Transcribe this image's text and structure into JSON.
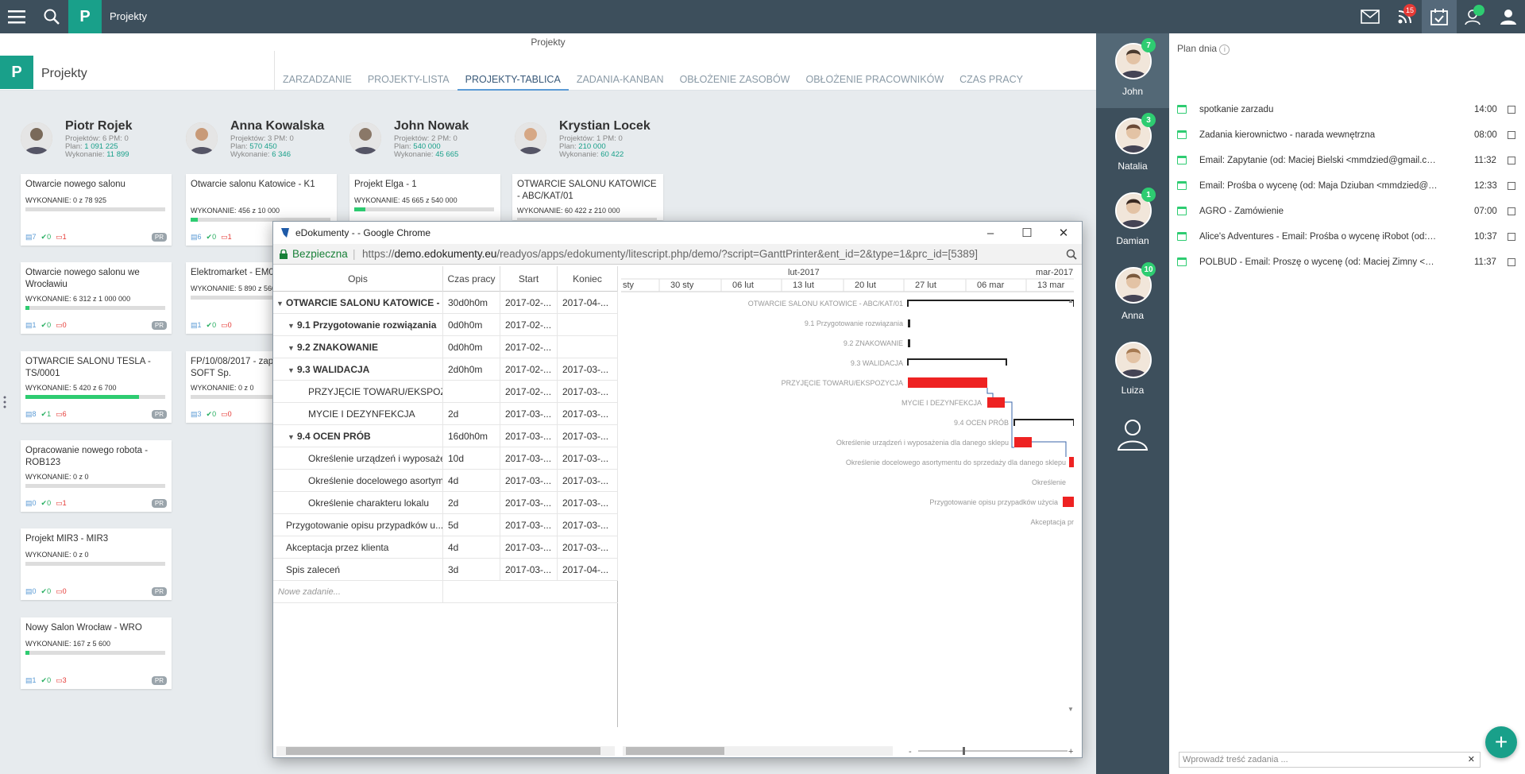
{
  "topbar": {
    "title": "Projekty",
    "notif_badge": "15",
    "logo": "P"
  },
  "breadcrumb": "Projekty",
  "header": {
    "title": "Projekty",
    "tabs": [
      "ZARZADZANIE",
      "PROJEKTY-LISTA",
      "PROJEKTY-TABLICA",
      "ZADANIA-KANBAN",
      "OBŁOŻENIE ZASOBÓW",
      "OBŁOŻENIE PRACOWNIKÓW",
      "CZAS PRACY"
    ],
    "active_tab": 2
  },
  "users": [
    {
      "name": "Piotr Rojek",
      "l1": "Projektów: 6 PM: 0",
      "plan_label": "Plan:",
      "plan": "1 091 225",
      "wyk_label": "Wykonanie:",
      "wyk": "11 899"
    },
    {
      "name": "Anna Kowalska",
      "l1": "Projektów: 3 PM: 0",
      "plan_label": "Plan:",
      "plan": "570 450",
      "wyk_label": "Wykonanie:",
      "wyk": "6 346"
    },
    {
      "name": "John Nowak",
      "l1": "Projektów: 2 PM: 0",
      "plan_label": "Plan:",
      "plan": "540 000",
      "wyk_label": "Wykonanie:",
      "wyk": "45 665"
    },
    {
      "name": "Krystian Locek",
      "l1": "Projektów: 1 PM: 0",
      "plan_label": "Plan:",
      "plan": "210 000",
      "wyk_label": "Wykonanie:",
      "wyk": "60 422"
    }
  ],
  "cards": [
    {
      "title": "Otwarcie nowego salonu",
      "wyk": "WYKONANIE: 0 z 78 925",
      "progress": 0.0,
      "i1": "7",
      "i2": "0",
      "i3": "1",
      "pr": "PR"
    },
    {
      "title": "Otwarcie nowego salonu we Wrocławiu",
      "wyk": "WYKONANIE: 6 312 z 1 000 000",
      "progress": 0.01,
      "i1": "1",
      "i2": "0",
      "i3": "0",
      "pr": "PR"
    },
    {
      "title": "OTWARCIE SALONU TESLA - TS/0001",
      "wyk": "WYKONANIE: 5 420 z 6 700",
      "progress": 0.81,
      "i1": "8",
      "i2": "1",
      "i3": "6",
      "pr": "PR"
    },
    {
      "title": "Opracowanie nowego robota - ROB123",
      "wyk": "WYKONANIE: 0 z 0",
      "progress": 0.0,
      "i1": "0",
      "i2": "0",
      "i3": "1",
      "pr": "PR"
    },
    {
      "title": "Projekt MIR3 - MIR3",
      "wyk": "WYKONANIE: 0 z 0",
      "progress": 0.0,
      "i1": "0",
      "i2": "0",
      "i3": "0",
      "pr": "PR"
    },
    {
      "title": "Nowy Salon Wrocław - WRO",
      "wyk": "WYKONANIE: 167 z 5 600",
      "progress": 0.03,
      "i1": "1",
      "i2": "0",
      "i3": "3",
      "pr": "PR"
    },
    {
      "title": "Otwarcie salonu Katowice - K1",
      "wyk": "WYKONANIE: 456 z 10 000",
      "progress": 0.05,
      "i1": "6",
      "i2": "0",
      "i3": "1",
      "pr": ""
    },
    {
      "title": "Elektromarket - EM01",
      "wyk": "WYKONANIE: 5 890 z 560",
      "progress": 0.0,
      "i1": "1",
      "i2": "0",
      "i3": "0",
      "pr": ""
    },
    {
      "title": "FP/10/08/2017 - zapyt ADHD-SOFT Sp.",
      "wyk": "WYKONANIE: 0 z 0",
      "progress": 0.0,
      "i1": "3",
      "i2": "0",
      "i3": "0",
      "pr": ""
    },
    {
      "title": "Projekt Elga - 1",
      "wyk": "WYKONANIE: 45 665 z 540 000",
      "progress": 0.08,
      "i1": "",
      "i2": "",
      "i3": "",
      "pr": ""
    },
    {
      "title": "OTWARCIE SALONU KATOWICE - ABC/KAT/01",
      "wyk": "WYKONANIE: 60 422 z 210 000",
      "progress": 0.0,
      "i1": "",
      "i2": "",
      "i3": "",
      "pr": ""
    }
  ],
  "popup": {
    "title": "eDokumenty - - Google Chrome",
    "secure": "Bezpieczna",
    "url_pre": "https://",
    "url_host": "demo.edokumenty.eu",
    "url_rest": "/readyos/apps/edokumenty/litescript.php/demo/?script=GanttPrinter&ent_id=2&type=1&prc_id=[5389]",
    "columns": [
      "Opis",
      "Czas pracy",
      "Start",
      "Koniec"
    ],
    "rows": [
      {
        "name": "OTWARCIE SALONU KATOWICE - ...",
        "czas": "30d0h0m",
        "start": "2017-02-...",
        "koniec": "2017-04-...",
        "lvl": 0,
        "bold": true,
        "arrow": true
      },
      {
        "name": "9.1 Przygotowanie rozwiązania",
        "czas": "0d0h0m",
        "start": "2017-02-...",
        "koniec": "",
        "lvl": 1,
        "bold": true,
        "arrow": true
      },
      {
        "name": "9.2 ZNAKOWANIE",
        "czas": "0d0h0m",
        "start": "2017-02-...",
        "koniec": "",
        "lvl": 1,
        "bold": true,
        "arrow": true
      },
      {
        "name": "9.3 WALIDACJA",
        "czas": "2d0h0m",
        "start": "2017-02-...",
        "koniec": "2017-03-...",
        "lvl": 1,
        "bold": true,
        "arrow": true
      },
      {
        "name": "PRZYJĘCIE TOWARU/EKSPOZYCJA",
        "czas": "",
        "start": "2017-02-...",
        "koniec": "2017-03-...",
        "lvl": 2,
        "bold": false,
        "arrow": false
      },
      {
        "name": "MYCIE I DEZYNFEKCJA",
        "czas": "2d",
        "start": "2017-03-...",
        "koniec": "2017-03-...",
        "lvl": 2,
        "bold": false,
        "arrow": false
      },
      {
        "name": "9.4 OCEN PRÓB",
        "czas": "16d0h0m",
        "start": "2017-03-...",
        "koniec": "2017-03-...",
        "lvl": 1,
        "bold": true,
        "arrow": true
      },
      {
        "name": "Określenie urządzeń i wyposażeni...",
        "czas": "10d",
        "start": "2017-03-...",
        "koniec": "2017-03-...",
        "lvl": 2,
        "bold": false,
        "arrow": false
      },
      {
        "name": "Określenie docelowego asortyme...",
        "czas": "4d",
        "start": "2017-03-...",
        "koniec": "2017-03-...",
        "lvl": 2,
        "bold": false,
        "arrow": false
      },
      {
        "name": "Określenie charakteru lokalu",
        "czas": "2d",
        "start": "2017-03-...",
        "koniec": "2017-03-...",
        "lvl": 2,
        "bold": false,
        "arrow": false
      },
      {
        "name": "Przygotowanie opisu przypadków u...",
        "czas": "5d",
        "start": "2017-03-...",
        "koniec": "2017-03-...",
        "lvl": 0,
        "bold": false,
        "arrow": false
      },
      {
        "name": "Akceptacja przez klienta",
        "czas": "4d",
        "start": "2017-03-...",
        "koniec": "2017-03-...",
        "lvl": 0,
        "bold": false,
        "arrow": false
      },
      {
        "name": "Spis zaleceń",
        "czas": "3d",
        "start": "2017-03-...",
        "koniec": "2017-04-...",
        "lvl": 0,
        "bold": false,
        "arrow": false
      }
    ],
    "new_task": "Nowe zadanie...",
    "months": [
      "lut-2017",
      "mar-2017"
    ],
    "weeks": [
      "sty",
      "30 sty",
      "06 lut",
      "13 lut",
      "20 lut",
      "27 lut",
      "06 mar",
      "13 mar"
    ],
    "gantt_labels": [
      "OTWARCIE SALONU KATOWICE - ABC/KAT/01",
      "9.1 Przygotowanie rozwiązania",
      "9.2 ZNAKOWANIE",
      "9.3 WALIDACJA",
      "PRZYJĘCIE TOWARU/EKSPOZYCJA",
      "MYCIE I DEZYNFEKCJA",
      "9.4 OCEN PRÓB",
      "Określenie urządzeń i wyposażenia dla danego sklepu",
      "Określenie docelowego asortymentu do sprzedaży dla danego sklepu",
      "Określenie",
      "Przygotowanie opisu przypadków użycia",
      "Akceptacja pr"
    ]
  },
  "people": [
    {
      "name": "John",
      "badge": "7"
    },
    {
      "name": "Natalia",
      "badge": "3"
    },
    {
      "name": "Damian",
      "badge": "1"
    },
    {
      "name": "Anna",
      "badge": "10"
    },
    {
      "name": "Luiza",
      "badge": ""
    }
  ],
  "plan": {
    "title": "Plan dnia",
    "items": [
      {
        "text": "spotkanie zarzadu",
        "time": "14:00"
      },
      {
        "text": "Zadania kierownictwo - narada wewnętrzna",
        "time": "08:00"
      },
      {
        "text": "Email: Zapytanie (od: Maciej Bielski <mmdzied@gmail.com>, z ...",
        "time": "11:32"
      },
      {
        "text": "Email: Prośba o wycenę (od: Maja Dziuban <mmdzied@gmail.c...",
        "time": "12:33"
      },
      {
        "text": "AGRO - Zamówienie",
        "time": "07:00"
      },
      {
        "text": "Alice's Adventures - Email: Prośba o wycenę iRobot (od: Alicja K...",
        "time": "10:37"
      },
      {
        "text": "POLBUD - Email: Proszę o wycenę (od: Maciej Zimny <mmdzied...",
        "time": "11:37"
      }
    ],
    "add_placeholder": "Wprowadź treść zadania ...",
    "add_clear": "✕"
  },
  "icons": {
    "menu": "menu-icon",
    "search": "search-icon",
    "mail": "mail-icon",
    "rss": "rss-icon",
    "calendar": "calendar-check-icon",
    "user": "user-icon",
    "plus": "plus-icon"
  }
}
